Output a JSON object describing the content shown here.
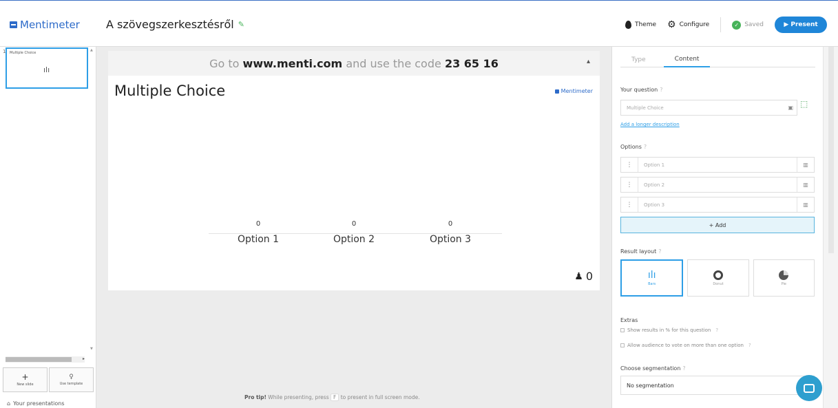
{
  "header": {
    "logo": "Mentimeter",
    "title": "A szövegszerkesztésről",
    "theme_label": "Theme",
    "configure_label": "Configure",
    "saved_label": "Saved",
    "present_label": "▶ Present"
  },
  "sidebar": {
    "slide_number": "1",
    "slide_title": "Multiple Choice",
    "new_slide": "New slide",
    "use_template": "Use template",
    "your_presentations": "Your presentations"
  },
  "slide": {
    "code_prefix": "Go to ",
    "code_site": "www.menti.com",
    "code_middle": " and use the code ",
    "code": "23 65 16",
    "question": "Multiple Choice",
    "brand": "Mentimeter",
    "options": [
      {
        "label": "Option 1",
        "count": "0"
      },
      {
        "label": "Option 2",
        "count": "0"
      },
      {
        "label": "Option 3",
        "count": "0"
      }
    ],
    "participants": "0"
  },
  "pro_tip": {
    "bold": "Pro tip!",
    "before": " While presenting, press ",
    "key": "F",
    "after": " to present in full screen mode."
  },
  "panel": {
    "tab_type": "Type",
    "tab_content": "Content",
    "your_question_label": "Your question",
    "question_placeholder": "Multiple Choice",
    "add_image_link": "Add a longer description",
    "options_label": "Options",
    "options": [
      "Option 1",
      "Option 2",
      "Option 3"
    ],
    "add_label": "+ Add",
    "result_layout_label": "Result layout",
    "layouts": [
      {
        "label": "Bars",
        "active": true
      },
      {
        "label": "Donut",
        "active": false
      },
      {
        "label": "Pie",
        "active": false
      }
    ],
    "extras_label": "Extras",
    "extra_1": "Show results in % for this question",
    "extra_2": "Allow audience to vote on more than one option",
    "segmentation_label": "Choose segmentation",
    "segmentation_value": "No segmentation"
  },
  "colors": {
    "accent": "#2d9ee6",
    "brand": "#2d6bc9",
    "present": "#1f86d8",
    "saved": "#48b35a"
  }
}
